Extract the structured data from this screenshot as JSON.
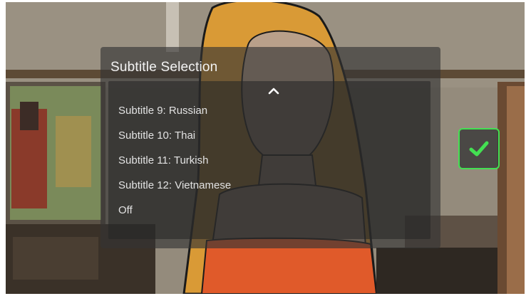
{
  "dialog": {
    "title": "Subtitle Selection",
    "scroll_up_icon": "chevron-up-icon",
    "items": [
      {
        "label": "Subtitle 9: Russian"
      },
      {
        "label": "Subtitle 10: Thai"
      },
      {
        "label": "Subtitle 11: Turkish"
      },
      {
        "label": "Subtitle 12: Vietnamese"
      },
      {
        "label": "Off"
      }
    ]
  },
  "confirm": {
    "icon": "checkmark-icon",
    "accent_color": "#43e052"
  }
}
